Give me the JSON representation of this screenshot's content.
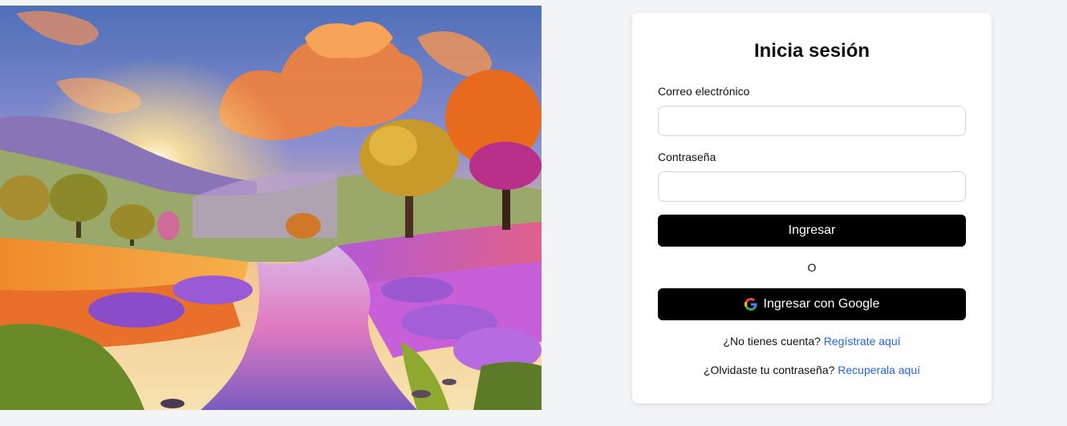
{
  "hero": {
    "image_icon": "landscape-illustration",
    "description_colors": {
      "sky_top": "#5f7fc0",
      "sunset": "#f9b24a",
      "clouds": "#f07a3a",
      "lavender": "#9b59d0",
      "river": "#c77bd6"
    }
  },
  "login": {
    "title": "Inicia sesión",
    "email_label": "Correo electrónico",
    "email_value": "",
    "password_label": "Contraseña",
    "password_value": "",
    "submit_label": "Ingresar",
    "or_text": "O",
    "google_label": "Ingresar con Google",
    "google_icon": "google-g-icon",
    "register_prompt": "¿No tienes cuenta?",
    "register_link": "Regístrate aquí",
    "recover_prompt": "¿Olvidaste tu contraseña?",
    "recover_link": "Recuperala aquí"
  },
  "colors": {
    "button_bg": "#000000",
    "link": "#2563eb",
    "page_bg": "#f3f4f6"
  }
}
